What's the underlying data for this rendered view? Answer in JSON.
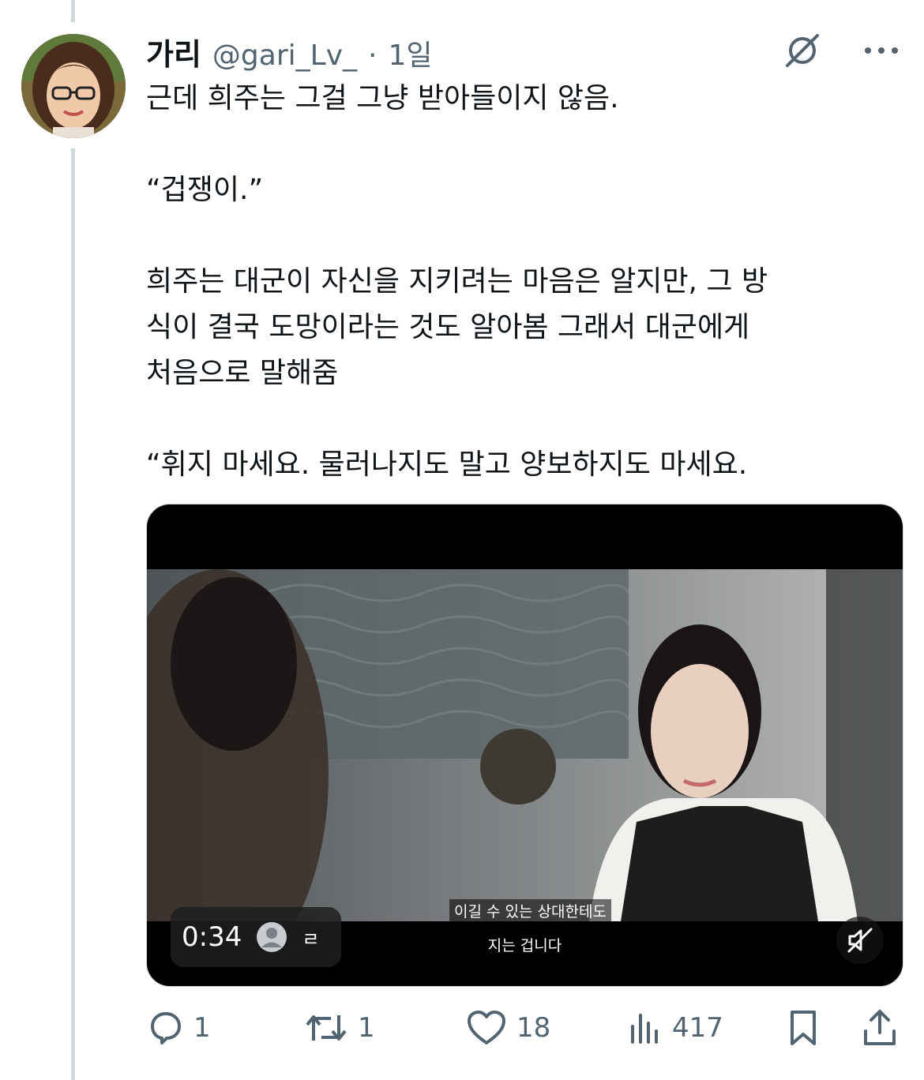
{
  "author": {
    "name": "가리",
    "handle": "@gari_Lv_",
    "separator": "·",
    "time": "1일",
    "avatar": "avatar-portrait"
  },
  "top_icons": [
    "grok-icon",
    "more-icon"
  ],
  "tweet": {
    "paragraphs": [
      "근데 희주는 그걸 그냥 받아들이지 않음.",
      "“겁쟁이.”",
      "희주는 대군이 자신을 지키려는 마음은 알지만, 그 방\n식이 결국 도망이라는 것도 알아봄 그래서 대군에게\n처음으로 말해줌",
      "“휘지 마세요. 물러나지도 말고 양보하지도 마세요."
    ]
  },
  "video": {
    "timecode": "0:34",
    "caption_glyph": "ㄹ",
    "subtitle_line1": "이길 수 있는 상대한테도",
    "subtitle_line2": "지는 겁니다",
    "mute_icon": "muted-speaker-icon"
  },
  "actions": {
    "replies": "1",
    "reposts": "1",
    "likes": "18",
    "views": "417"
  },
  "colors": {
    "text": "#0f1419",
    "secondary": "#536471",
    "thread_line": "#cfd9de"
  }
}
